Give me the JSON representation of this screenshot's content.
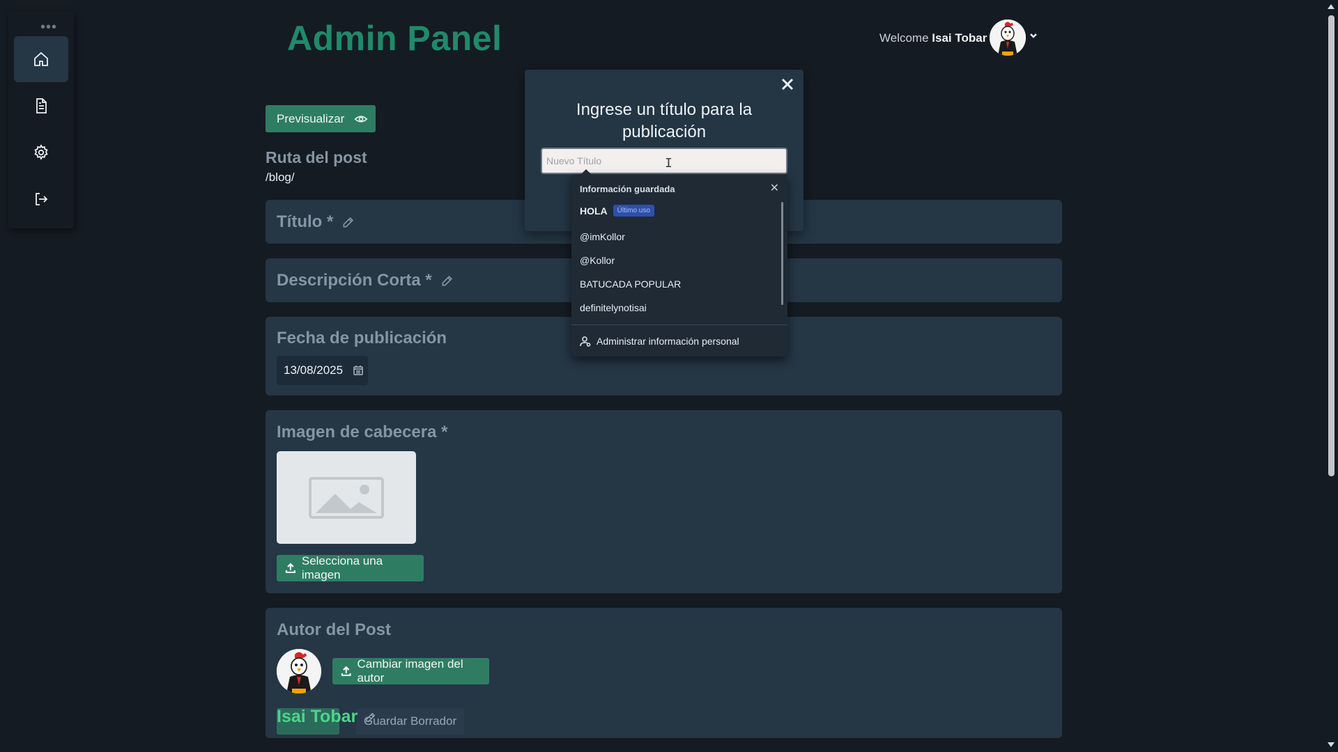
{
  "header": {
    "title": "Admin Panel",
    "welcome_prefix": "Welcome",
    "user_name": "Isai Tobar"
  },
  "sidebar": {
    "items": [
      {
        "icon": "home-icon"
      },
      {
        "icon": "document-icon"
      },
      {
        "icon": "gear-icon"
      },
      {
        "icon": "logout-icon"
      }
    ]
  },
  "toolbar": {
    "preview_label": "Previsualizar"
  },
  "route": {
    "label": "Ruta del post",
    "value": "/blog/"
  },
  "form": {
    "title_label": "Título *",
    "short_desc_label": "Descripción Corta *",
    "date_label": "Fecha de publicación",
    "date_value": "13/08/2025",
    "header_image_label": "Imagen de cabecera *",
    "select_image_label": "Selecciona una imagen",
    "author_section_label": "Autor del Post",
    "change_author_image_label": "Cambiar imagen del autor",
    "author_name": "Isai Tobar",
    "save_draft_label": "Guardar Borrador"
  },
  "modal": {
    "heading": "Ingrese un título para la publicación",
    "input_placeholder": "Nuevo Título",
    "input_value": ""
  },
  "autofill": {
    "header": "Información guardada",
    "items": [
      {
        "text": "HOLA",
        "badge": "Último uso"
      },
      {
        "text": "@imKollor"
      },
      {
        "text": "@Kollor"
      },
      {
        "text": "BATUCADA POPULAR"
      },
      {
        "text": "definitelynotisai"
      }
    ],
    "manage_label": "Administrar información personal"
  },
  "colors": {
    "accent": "#2e7d63",
    "title_green": "#1f8a6a",
    "card_bg": "#253645",
    "page_bg": "#151b22",
    "author_name_green": "#4fd38b"
  }
}
